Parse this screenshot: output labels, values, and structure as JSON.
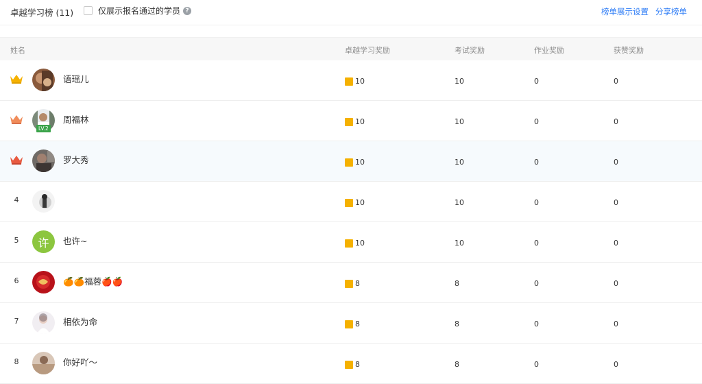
{
  "header": {
    "title": "卓越学习榜 (11)",
    "filter_label": "仅展示报名通过的学员",
    "links": [
      "榜单展示设置",
      "分享榜单"
    ]
  },
  "columns": [
    "姓名",
    "卓越学习奖励",
    "考试奖励",
    "作业奖励",
    "获赞奖励"
  ],
  "colors": {
    "accent": "#2f7df6",
    "medal": "#f5b100",
    "crown_1": "#f5b100",
    "crown_2": "#f08c5a",
    "crown_3": "#e85a40",
    "level_badge": "#3aa34a"
  },
  "rows": [
    {
      "rank": "1",
      "rank_icon": "crown-gold-icon",
      "avatar": "photo-avatar",
      "name": "语瑶儿",
      "reward": "10",
      "exam": "10",
      "homework": "0",
      "likes": "0"
    },
    {
      "rank": "2",
      "rank_icon": "crown-silver-icon",
      "avatar": "photo-avatar",
      "name": "周福林",
      "level": "LV.2",
      "reward": "10",
      "exam": "10",
      "homework": "0",
      "likes": "0"
    },
    {
      "rank": "3",
      "rank_icon": "crown-bronze-icon",
      "avatar": "photo-avatar",
      "name": "罗大秀",
      "reward": "10",
      "exam": "10",
      "homework": "0",
      "likes": "0"
    },
    {
      "rank": "4",
      "avatar": "photo-avatar",
      "name": "",
      "reward": "10",
      "exam": "10",
      "homework": "0",
      "likes": "0"
    },
    {
      "rank": "5",
      "avatar": "letter-avatar",
      "avatar_letter": "许",
      "name": "也许~",
      "reward": "10",
      "exam": "10",
      "homework": "0",
      "likes": "0"
    },
    {
      "rank": "6",
      "avatar": "photo-avatar",
      "name": "🍊🍊福蓉🍎🍎",
      "reward": "8",
      "exam": "8",
      "homework": "0",
      "likes": "0"
    },
    {
      "rank": "7",
      "avatar": "photo-avatar",
      "name": "相依为命",
      "reward": "8",
      "exam": "8",
      "homework": "0",
      "likes": "0"
    },
    {
      "rank": "8",
      "avatar": "photo-avatar",
      "name": "你好吖～",
      "reward": "8",
      "exam": "8",
      "homework": "0",
      "likes": "0"
    }
  ]
}
